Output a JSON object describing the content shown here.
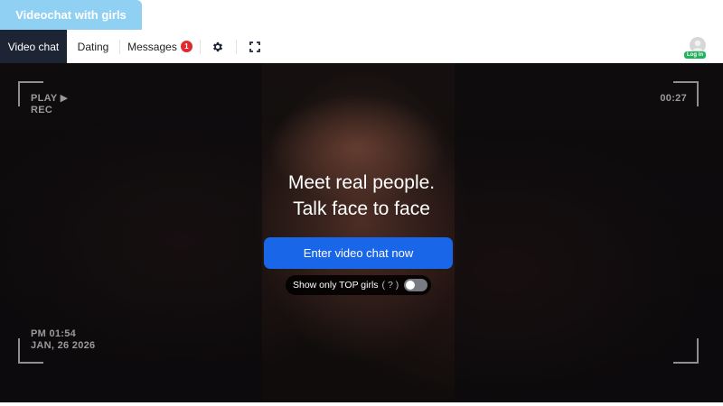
{
  "header": {
    "tab_label": "Videochat with girls"
  },
  "nav": {
    "items": [
      {
        "label": "Video chat"
      },
      {
        "label": "Dating"
      },
      {
        "label": "Messages",
        "badge": "1"
      }
    ],
    "settings_icon": "gear-icon",
    "fullscreen_icon": "fullscreen-icon",
    "login_label": "Log in"
  },
  "stage": {
    "hud_top_left": [
      "PLAY ▶",
      "REC"
    ],
    "hud_top_right": "00:27",
    "hud_bottom_left": [
      "PM 01:54",
      "JAN, 26 2026"
    ],
    "headline_line1": "Meet real people.",
    "headline_line2": "Talk face to face",
    "cta_label": "Enter video chat now",
    "toggle": {
      "label": "Show only TOP girls",
      "help": "( ? )",
      "enabled": false
    }
  },
  "colors": {
    "tab_bg": "#8fd0f3",
    "nav_active": "#1d2535",
    "cta": "#1a66e8",
    "badge": "#e0292e",
    "login": "#1fb45a"
  }
}
